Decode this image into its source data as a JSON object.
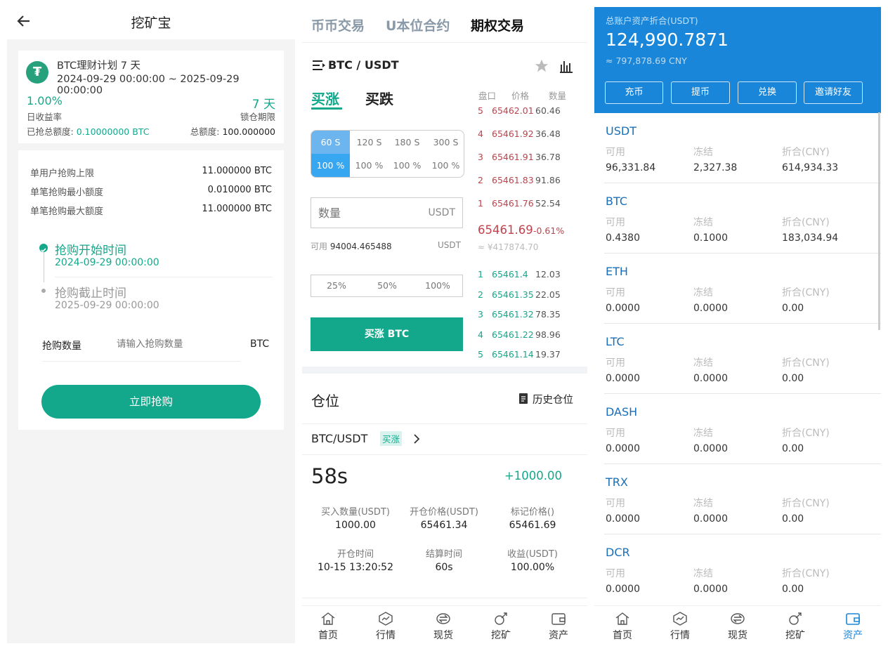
{
  "p1": {
    "title": "挖矿宝",
    "plan": {
      "name": "BTC理财计划 7 天",
      "period": "2024-09-29 00:00:00 ~ 2025-09-29 00:00:00",
      "rate": "1.00%",
      "rate_label": "日收益率",
      "lock": "7 天",
      "lock_label": "锁仓期限",
      "sold_label": "已抢总额度:",
      "sold_value": "0.10000000 BTC",
      "total_label": "总额度:",
      "total_value": "100.000000"
    },
    "limits": [
      {
        "label": "单用户抢购上限",
        "value": "11.000000 BTC"
      },
      {
        "label": "单笔抢购最小额度",
        "value": "0.010000 BTC"
      },
      {
        "label": "单笔抢购最大额度",
        "value": "11.000000 BTC"
      }
    ],
    "timeline": [
      {
        "label": "抢购开始时间",
        "time": "2024-09-29 00:00:00"
      },
      {
        "label": "抢购截止时间",
        "time": "2025-09-29 00:00:00"
      }
    ],
    "amount_label": "抢购数量",
    "amount_placeholder": "请输入抢购数量",
    "amount_unit": "BTC",
    "buy_button": "立即抢购"
  },
  "p2": {
    "tabs": [
      "币币交易",
      "U本位合约",
      "期权交易"
    ],
    "pair": "BTC / USDT",
    "side_buy": "买涨",
    "side_sell": "买跌",
    "durations": [
      "60 S",
      "120 S",
      "180 S",
      "300 S"
    ],
    "rates": [
      "100 %",
      "100 %",
      "100 %",
      "100 %"
    ],
    "qty_placeholder": "数量",
    "qty_unit": "USDT",
    "avail_label": "可用",
    "avail_value": "94004.465488",
    "avail_unit": "USDT",
    "percents": [
      "25%",
      "50%",
      "100%"
    ],
    "submit": "买涨 BTC",
    "ob_headers": [
      "盘口",
      "价格",
      "数量"
    ],
    "asks": [
      {
        "i": "5",
        "p": "65462.01",
        "q": "60.46"
      },
      {
        "i": "4",
        "p": "65461.92",
        "q": "36.48"
      },
      {
        "i": "3",
        "p": "65461.91",
        "q": "36.78"
      },
      {
        "i": "2",
        "p": "65461.83",
        "q": "91.86"
      },
      {
        "i": "1",
        "p": "65461.76",
        "q": "52.54"
      }
    ],
    "last_price": "65461.69",
    "last_change": "-0.61%",
    "last_cny": "≈ ¥417874.70",
    "bids": [
      {
        "i": "1",
        "p": "65461.4",
        "q": "12.03"
      },
      {
        "i": "2",
        "p": "65461.35",
        "q": "22.05"
      },
      {
        "i": "3",
        "p": "65461.32",
        "q": "78.35"
      },
      {
        "i": "4",
        "p": "65461.22",
        "q": "98.96"
      },
      {
        "i": "5",
        "p": "65461.14",
        "q": "19.37"
      }
    ],
    "position_title": "仓位",
    "history_label": "历史仓位",
    "pos_pair": "BTC/USDT",
    "pos_tag": "买涨",
    "countdown": "58s",
    "pnl": "+1000.00",
    "pos_fields": [
      {
        "label": "买入数量(USDT)",
        "value": "1000.00"
      },
      {
        "label": "开仓价格(USDT)",
        "value": "65461.34"
      },
      {
        "label": "标记价格()",
        "value": "65461.69"
      },
      {
        "label": "开仓时间",
        "value": "10-15 13:20:52"
      },
      {
        "label": "结算时间",
        "value": "60s"
      },
      {
        "label": "收益(USDT)",
        "value": "100.00%"
      }
    ]
  },
  "p3": {
    "total_label": "总账户资产折合(USDT)",
    "total_value": "124,990.7871",
    "total_cny": "≈ 797,878.69 CNY",
    "buttons": [
      "充币",
      "提币",
      "兑换",
      "邀请好友"
    ],
    "col_labels": [
      "可用",
      "冻结",
      "折合(CNY)"
    ],
    "assets": [
      {
        "name": "USDT",
        "avail": "96,331.84",
        "frozen": "2,327.38",
        "cny": "614,934.33"
      },
      {
        "name": "BTC",
        "avail": "0.4380",
        "frozen": "0.1000",
        "cny": "183,034.94"
      },
      {
        "name": "ETH",
        "avail": "0.0000",
        "frozen": "0.0000",
        "cny": "0.00"
      },
      {
        "name": "LTC",
        "avail": "0.0000",
        "frozen": "0.0000",
        "cny": "0.00"
      },
      {
        "name": "DASH",
        "avail": "0.0000",
        "frozen": "0.0000",
        "cny": "0.00"
      },
      {
        "name": "TRX",
        "avail": "0.0000",
        "frozen": "0.0000",
        "cny": "0.00"
      },
      {
        "name": "DCR",
        "avail": "0.0000",
        "frozen": "0.0000",
        "cny": "0.00"
      }
    ]
  },
  "nav": [
    "首页",
    "行情",
    "现货",
    "挖矿",
    "资产"
  ],
  "colors": {
    "green": "#13a88b",
    "blue": "#1a86d9",
    "red": "#c0424c"
  }
}
